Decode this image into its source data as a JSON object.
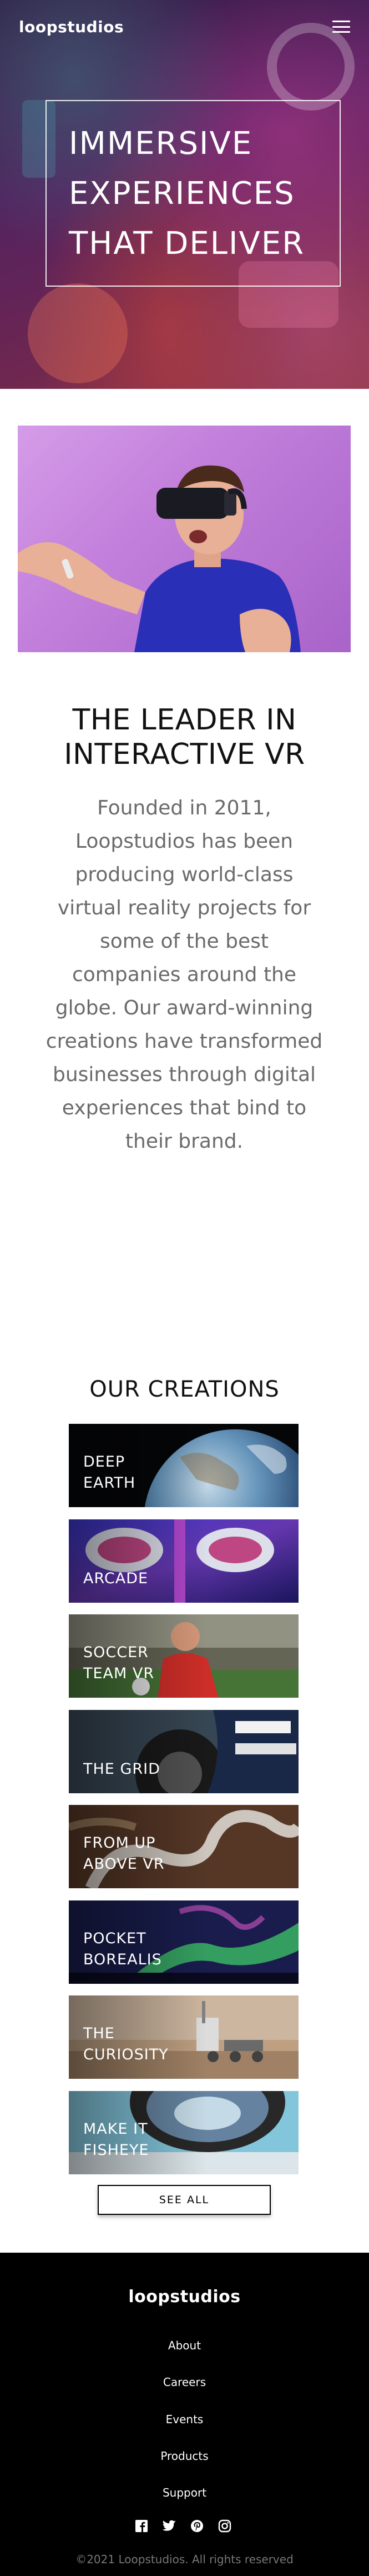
{
  "header": {
    "brand": "loopstudios",
    "menu_icon": "hamburger-icon"
  },
  "hero": {
    "lines": [
      "IMMERSIVE",
      "EXPERIENCES",
      "THAT DELIVER"
    ]
  },
  "leader": {
    "image_alt": "man-wearing-vr-headset",
    "title_lines": [
      "THE LEADER IN",
      "INTERACTIVE VR"
    ],
    "body": "Founded in 2011, Loopstudios has been producing world-class virtual reality projects for some of the best companies around the globe. Our award-winning creations have transformed businesses through digital experiences that bind to their brand."
  },
  "creations": {
    "heading": "OUR CREATIONS",
    "items": [
      {
        "lines": [
          "DEEP",
          "EARTH"
        ]
      },
      {
        "lines": [
          "ARCADE"
        ]
      },
      {
        "lines": [
          "SOCCER",
          "TEAM VR"
        ]
      },
      {
        "lines": [
          "THE GRID"
        ]
      },
      {
        "lines": [
          "FROM UP",
          "ABOVE VR"
        ]
      },
      {
        "lines": [
          "POCKET",
          "BOREALIS"
        ]
      },
      {
        "lines": [
          "THE",
          "CURIOSITY"
        ]
      },
      {
        "lines": [
          "MAKE IT",
          "FISHEYE"
        ]
      }
    ],
    "see_all": "SEE ALL"
  },
  "footer": {
    "brand": "loopstudios",
    "links": [
      "About",
      "Careers",
      "Events",
      "Products",
      "Support"
    ],
    "social_icons": [
      "facebook-icon",
      "twitter-icon",
      "pinterest-icon",
      "instagram-icon"
    ],
    "copyright": "©2021 Loopstudios. All rights reserved"
  }
}
